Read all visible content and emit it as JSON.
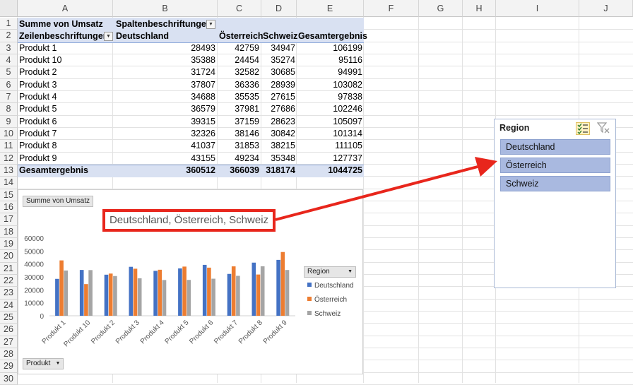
{
  "columns": [
    "A",
    "B",
    "C",
    "D",
    "E",
    "F",
    "G",
    "H",
    "I",
    "J"
  ],
  "rows": [
    "1",
    "2",
    "3",
    "4",
    "5",
    "6",
    "7",
    "8",
    "9",
    "10",
    "11",
    "12",
    "13",
    "14",
    "15",
    "16",
    "17",
    "18",
    "19",
    "20",
    "21",
    "22",
    "23",
    "24",
    "25",
    "26",
    "27",
    "28",
    "29",
    "30"
  ],
  "pivot": {
    "values_field": "Summe von Umsatz",
    "col_labels_header": "Spaltenbeschriftungen",
    "row_labels_header": "Zeilenbeschriftungen",
    "col_headers": [
      "Deutschland",
      "Österreich",
      "Schweiz",
      "Gesamtergebnis"
    ],
    "rows": [
      {
        "label": "Produkt 1",
        "values": [
          "28493",
          "42759",
          "34947",
          "106199"
        ]
      },
      {
        "label": "Produkt 10",
        "values": [
          "35388",
          "24454",
          "35274",
          "95116"
        ]
      },
      {
        "label": "Produkt 2",
        "values": [
          "31724",
          "32582",
          "30685",
          "94991"
        ]
      },
      {
        "label": "Produkt 3",
        "values": [
          "37807",
          "36336",
          "28939",
          "103082"
        ]
      },
      {
        "label": "Produkt 4",
        "values": [
          "34688",
          "35535",
          "27615",
          "97838"
        ]
      },
      {
        "label": "Produkt 5",
        "values": [
          "36579",
          "37981",
          "27686",
          "102246"
        ]
      },
      {
        "label": "Produkt 6",
        "values": [
          "39315",
          "37159",
          "28623",
          "105097"
        ]
      },
      {
        "label": "Produkt 7",
        "values": [
          "32326",
          "38146",
          "30842",
          "101314"
        ]
      },
      {
        "label": "Produkt 8",
        "values": [
          "41037",
          "31853",
          "38215",
          "111105"
        ]
      },
      {
        "label": "Produkt 9",
        "values": [
          "43155",
          "49234",
          "35348",
          "127737"
        ]
      }
    ],
    "total": {
      "label": "Gesamtergebnis",
      "values": [
        "360512",
        "366039",
        "318174",
        "1044725"
      ]
    }
  },
  "chart": {
    "values_button": "Summe von Umsatz",
    "axis_button": "Produkt",
    "legend_button": "Region"
  },
  "chart_data": {
    "type": "bar",
    "title": "Deutschland, Österreich, Schweiz",
    "categories": [
      "Produkt 1",
      "Produkt 10",
      "Produkt 2",
      "Produkt 3",
      "Produkt 4",
      "Produkt 5",
      "Produkt 6",
      "Produkt 7",
      "Produkt 8",
      "Produkt 9"
    ],
    "series": [
      {
        "name": "Deutschland",
        "color": "#4472c4",
        "values": [
          28493,
          35388,
          31724,
          37807,
          34688,
          36579,
          39315,
          32326,
          41037,
          43155
        ]
      },
      {
        "name": "Österreich",
        "color": "#ed7d31",
        "values": [
          42759,
          24454,
          32582,
          36336,
          35535,
          37981,
          37159,
          38146,
          31853,
          49234
        ]
      },
      {
        "name": "Schweiz",
        "color": "#a5a5a5",
        "values": [
          34947,
          35274,
          30685,
          28939,
          27615,
          27686,
          28623,
          30842,
          38215,
          35348
        ]
      }
    ],
    "yticks": [
      "0",
      "10000",
      "20000",
      "30000",
      "40000",
      "50000",
      "60000"
    ],
    "ylim": [
      0,
      60000
    ],
    "legend_position": "right",
    "grid": false
  },
  "slicer": {
    "title": "Region",
    "items": [
      "Deutschland",
      "Österreich",
      "Schweiz"
    ],
    "multiselect_icon": "multi-select-icon",
    "clear_filter_icon": "clear-filter-icon"
  },
  "annotation": {
    "color": "#e8261c"
  }
}
